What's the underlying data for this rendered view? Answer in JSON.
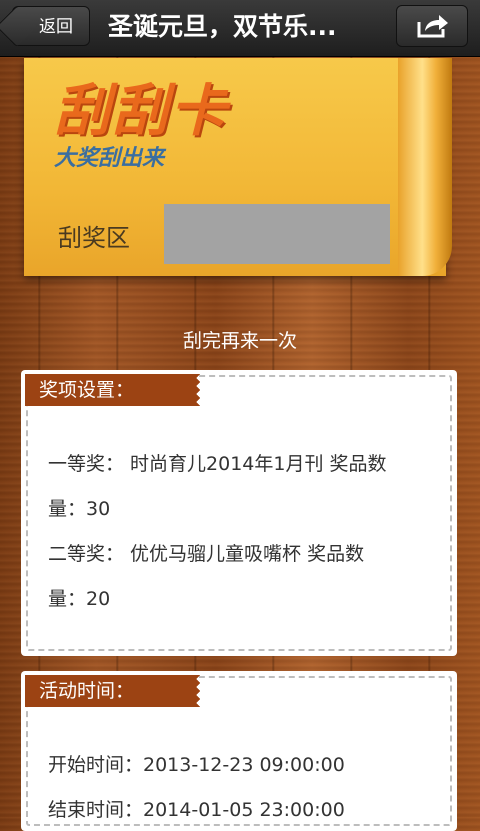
{
  "header": {
    "back_label": "返回",
    "title": "圣诞元旦，双节乐...",
    "share_icon": "share-icon"
  },
  "card": {
    "title": "刮刮卡",
    "subtitle": "大奖刮出来",
    "prize_area_label": "刮奖区"
  },
  "retry_text": "刮完再来一次",
  "prizes": {
    "heading": "奖项设置：",
    "lines": [
      "一等奖：  时尚育儿2014年1月刊 奖品数",
      "量：30",
      "二等奖：  优优马骝儿童吸嘴杯 奖品数",
      "量：20"
    ]
  },
  "time": {
    "heading": "活动时间：",
    "lines": [
      "开始时间：2013-12-23 09:00:00",
      "结束时间：2014-01-05 23:00:00"
    ]
  },
  "colors": {
    "header_bg": "#2a2a2a",
    "card_yellow": "#f2b736",
    "card_title": "#e9691c",
    "card_subtitle": "#3a6ea0",
    "tag_brown": "#9c4313",
    "scratch_gray": "#a3a3a3"
  }
}
